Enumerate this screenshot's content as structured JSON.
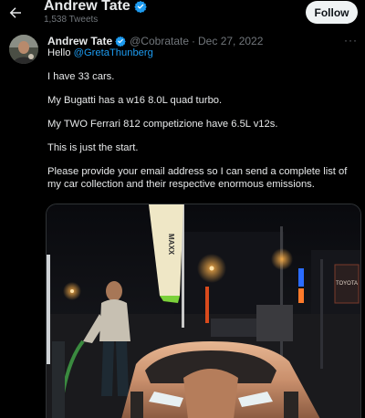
{
  "header": {
    "display_name": "Andrew Tate",
    "tweet_count": "1,538 Tweets",
    "follow_label": "Follow"
  },
  "tweet": {
    "display_name": "Andrew Tate",
    "handle": "@Cobratate",
    "separator": "·",
    "date": "Dec 27, 2022",
    "more": "···",
    "greeting_prefix": "Hello ",
    "mention": "@GretaThunberg",
    "lines": [
      "I have 33 cars.",
      "My Bugatti has a w16 8.0L quad turbo.",
      "My TWO Ferrari 812 competizione have 6.5L v12s.",
      "This is just the start.",
      "Please provide your email address so I can send a complete list of my car collection and their respective enormous emissions."
    ]
  },
  "media": {
    "banner_text": "MAXX",
    "sign_text": "TOYOTA"
  },
  "colors": {
    "background": "#000000",
    "text": "#e7e9ea",
    "secondary": "#71767b",
    "accent": "#1d9bf0",
    "follow_bg": "#eff3f4"
  }
}
